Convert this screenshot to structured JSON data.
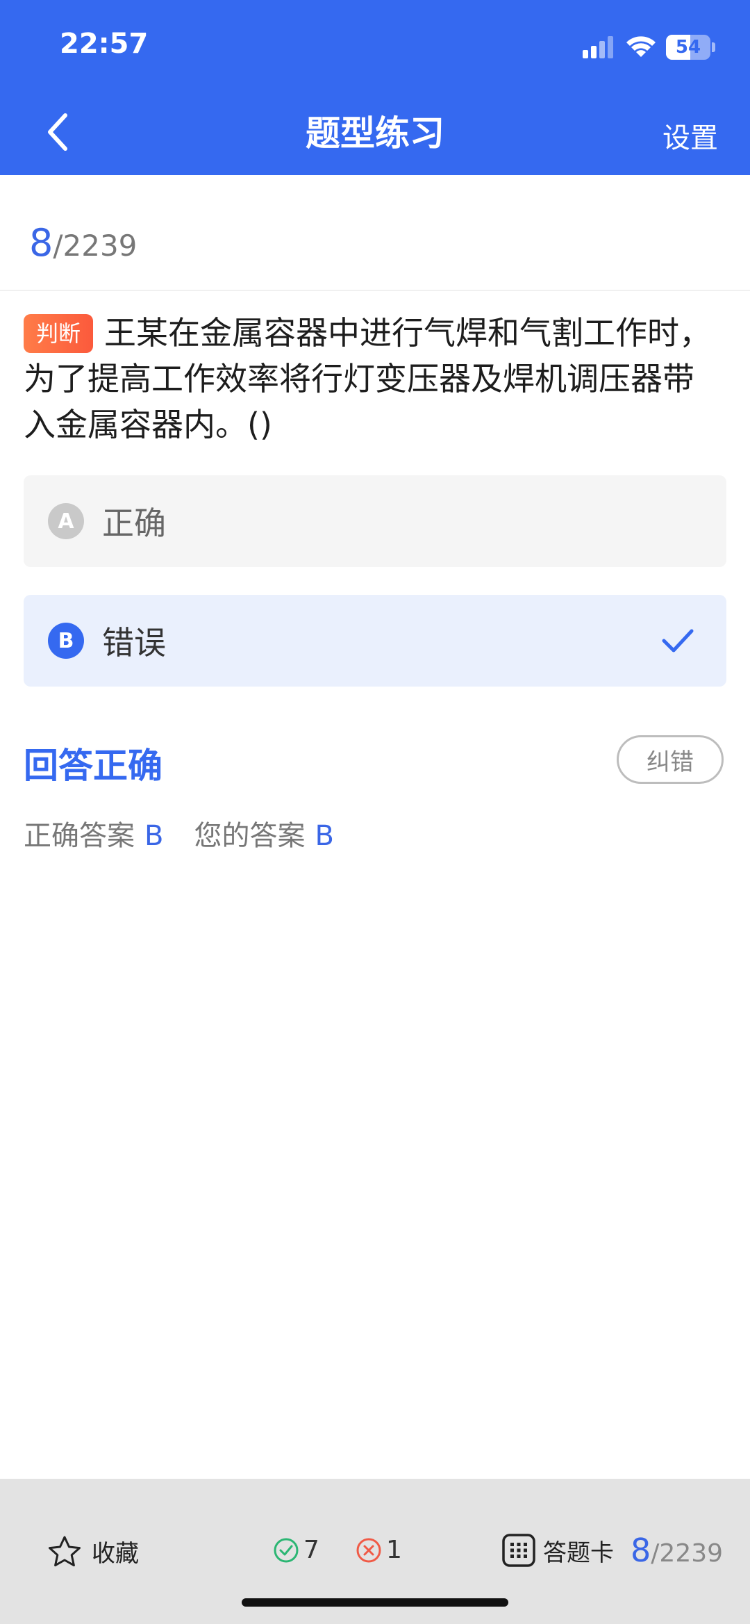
{
  "status_bar": {
    "time": "22:57",
    "battery": "54",
    "battery_level": 0.54
  },
  "nav": {
    "title": "题型练习",
    "settings": "设置"
  },
  "progress": {
    "current": "8",
    "total": "/2239"
  },
  "question": {
    "type_tag": "判断",
    "text": "王某在金属容器中进行气焊和气割工作时，为了提高工作效率将行灯变压器及焊机调压器带入金属容器内。()"
  },
  "options": [
    {
      "letter": "A",
      "text": "正确",
      "selected": false
    },
    {
      "letter": "B",
      "text": "错误",
      "selected": true
    }
  ],
  "result": {
    "title": "回答正确",
    "report_button": "纠错",
    "correct_label": "正确答案",
    "correct_value": "B",
    "yours_label": "您的答案",
    "yours_value": "B"
  },
  "bottom": {
    "favorite": "收藏",
    "correct_count": "7",
    "wrong_count": "1",
    "answer_card": "答题卡",
    "current": "8",
    "total": "/2239"
  },
  "colors": {
    "primary": "#3569f0",
    "tag": "#fb6a42",
    "correct": "#2bb673",
    "wrong": "#f05a46"
  }
}
